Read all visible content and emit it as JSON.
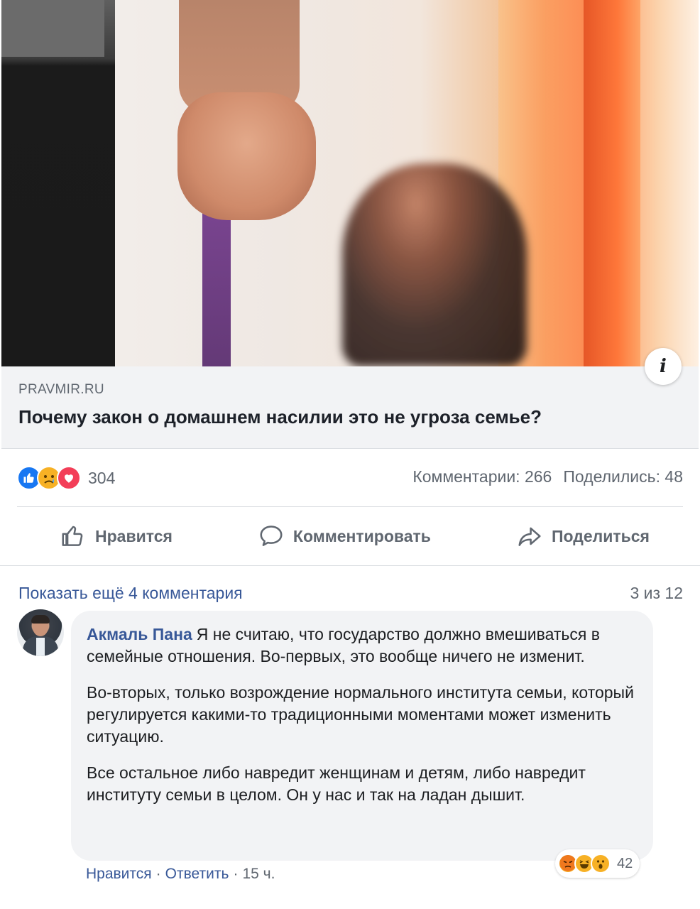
{
  "link_preview": {
    "domain": "PRAVMIR.RU",
    "title": "Почему закон о домашнем насилии это не угроза семье?",
    "info_icon": "info-icon"
  },
  "reactions": {
    "icons": [
      "like-icon",
      "sad-icon",
      "love-icon"
    ],
    "count": "304",
    "comments": "Комментарии: 266",
    "shares": "Поделились: 48"
  },
  "actions": {
    "like": "Нравится",
    "comment": "Комментировать",
    "share": "Поделиться"
  },
  "comments_section": {
    "show_more": "Показать ещё 4 комментария",
    "page_count": "3 из 12"
  },
  "comment": {
    "author": "Акмаль Пана",
    "paragraphs": [
      "Я не считаю, что государство должно вмешиваться в семейные отношения. Во-первых, это вообще ничего не изменит.",
      "Во-вторых, только возрождение нормального института семьи, который регулируется какими-то традиционными моментами может изменить ситуацию.",
      "Все остальное либо навредит женщинам и детям, либо навредит институту семьи в целом. Он у нас и так на ладан дышит."
    ],
    "reaction_icons": [
      "angry-icon",
      "haha-icon",
      "wow-icon"
    ],
    "reaction_count": "42",
    "like_label": "Нравится",
    "reply_label": "Ответить",
    "time": "15 ч.",
    "separator": "·"
  },
  "colors": {
    "link_blue": "#385898",
    "gray_text": "#606770",
    "bubble_bg": "#f2f3f5",
    "like_blue": "#1877f2",
    "love_red": "#f33e58",
    "emoji_yellow": "#f7b125"
  }
}
